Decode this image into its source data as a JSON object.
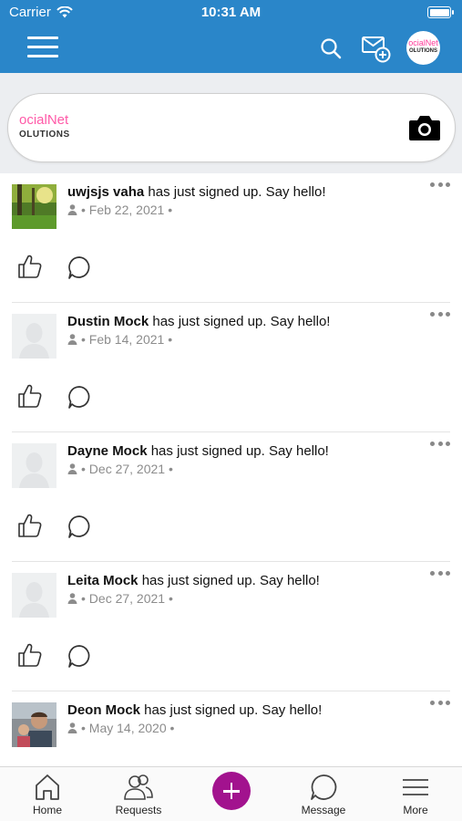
{
  "status_bar": {
    "carrier": "Carrier",
    "time": "10:31 AM"
  },
  "nav": {
    "logo_top": "ocialNet",
    "logo_bottom": "OLUTIONS"
  },
  "composer": {
    "logo_top": "ocialNet",
    "logo_bottom": "OLUTIONS"
  },
  "feed": [
    {
      "name": "uwjsjs vaha",
      "action": " has just signed up. Say hello!",
      "meta": "• Feb 22, 2021 •",
      "avatar": "forest-photo"
    },
    {
      "name": "Dustin Mock",
      "action": " has just signed up. Say hello!",
      "meta": "• Feb 14, 2021 •",
      "avatar": "placeholder"
    },
    {
      "name": "Dayne Mock",
      "action": " has just signed up. Say hello!",
      "meta": "• Dec 27, 2021 •",
      "avatar": "placeholder"
    },
    {
      "name": "Leita Mock",
      "action": " has just signed up. Say hello!",
      "meta": "• Dec 27, 2021 •",
      "avatar": "placeholder"
    },
    {
      "name": "Deon Mock",
      "action": " has just signed up. Say hello!",
      "meta": "• May 14, 2020 •",
      "avatar": "people-photo"
    }
  ],
  "tabbar": {
    "home": "Home",
    "requests": "Requests",
    "message": "Message",
    "more": "More"
  },
  "colors": {
    "header": "#2a86c9",
    "accent": "#a2128e",
    "background": "#eceef1"
  }
}
